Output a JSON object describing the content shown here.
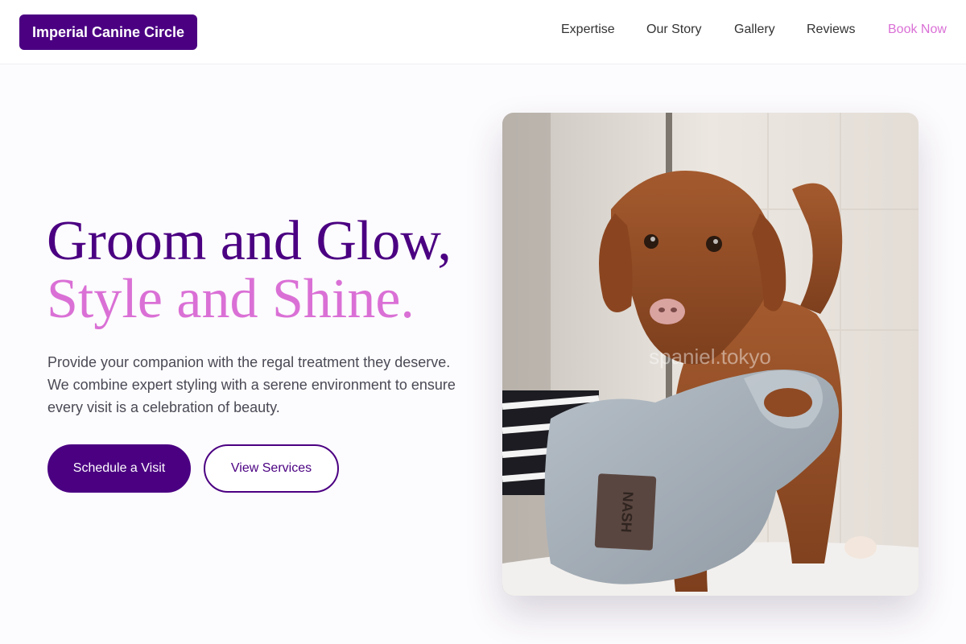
{
  "header": {
    "logo": "Imperial Canine Circle",
    "nav": {
      "expertise": "Expertise",
      "story": "Our Story",
      "gallery": "Gallery",
      "reviews": "Reviews",
      "book": "Book Now"
    }
  },
  "hero": {
    "title_line1": "Groom and Glow,",
    "title_line2": "Style and Shine.",
    "description": "Provide your companion with the regal treatment they deserve. We combine expert styling with a serene environment to ensure every visit is a celebration of beauty.",
    "primary_button": "Schedule a Visit",
    "secondary_button": "View Services",
    "image": {
      "watermark": "spaniel.tokyo",
      "towel_label": "NASH"
    }
  },
  "colors": {
    "brand": "#4b0082",
    "accent": "#da70d6",
    "background": "#fcfbfd"
  }
}
